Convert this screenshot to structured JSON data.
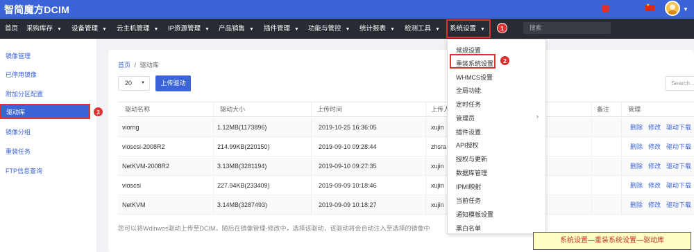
{
  "app": {
    "brand": "智简魔方DCIM"
  },
  "nav": {
    "items": [
      {
        "label": "首页",
        "caret": false
      },
      {
        "label": "采购库存",
        "caret": true
      },
      {
        "label": "设备管理",
        "caret": true
      },
      {
        "label": "云主机管理",
        "caret": true
      },
      {
        "label": "IP资源管理",
        "caret": true
      },
      {
        "label": "产品销售",
        "caret": true
      },
      {
        "label": "插件管理",
        "caret": true
      },
      {
        "label": "功能与管控",
        "caret": true
      },
      {
        "label": "统计报表",
        "caret": true
      },
      {
        "label": "检测工具",
        "caret": true
      },
      {
        "label": "系统设置",
        "caret": true
      }
    ],
    "search_placeholder": "搜索"
  },
  "badges": {
    "one": "1",
    "two": "2",
    "three": "3"
  },
  "sidebar": {
    "items": [
      {
        "label": "镜像管理"
      },
      {
        "label": "已停用镜像"
      },
      {
        "label": "附加分区配置"
      },
      {
        "label": "驱动库"
      },
      {
        "label": "镜像分组"
      },
      {
        "label": "重装任务"
      },
      {
        "label": "FTP信息查询"
      }
    ]
  },
  "breadcrumb": {
    "home": "首页",
    "separator": "/",
    "current": "驱动库"
  },
  "toolbar": {
    "page_size": "20",
    "upload_label": "上传驱动",
    "search_placeholder": "Search..."
  },
  "table": {
    "headers": [
      "驱动名称",
      "驱动大小",
      "上传时间",
      "上传人",
      "备注",
      "管理"
    ],
    "rows": [
      {
        "name": "viorng",
        "size": "1.12MB(1173896)",
        "time": "2019-10-25 16:36:05",
        "user": "xujin"
      },
      {
        "name": "vioscsi-2008R2",
        "size": "214.99KB(220150)",
        "time": "2019-09-10 09:28:44",
        "user": "zhsra"
      },
      {
        "name": "NetKVM-2008R2",
        "size": "3.13MB(3281194)",
        "time": "2019-09-10 09:27:35",
        "user": "xujin"
      },
      {
        "name": "vioscsi",
        "size": "227.94KB(233409)",
        "time": "2019-09-09 10:18:46",
        "user": "xujin"
      },
      {
        "name": "NetKVM",
        "size": "3.14MB(3287493)",
        "time": "2019-09-09 10:18:27",
        "user": "xujin"
      }
    ],
    "actions": {
      "delete": "删除",
      "edit": "修改",
      "download": "驱动下载"
    }
  },
  "hint": "您可以将Wdinwos驱动上传至DCIM，随后在镜像管理-修改中，选择该驱动，该驱动将会自动注入至选择的镜像中",
  "dropdown": {
    "items": [
      {
        "label": "常规设置"
      },
      {
        "label": "重装系统设置"
      },
      {
        "label": "WHMCS设置"
      },
      {
        "label": "全局功能"
      },
      {
        "label": "定时任务"
      },
      {
        "label": "管理员",
        "submenu": true
      },
      {
        "label": "插件设置"
      },
      {
        "label": "API授权"
      },
      {
        "label": "授权与更新"
      },
      {
        "label": "数据库管理"
      },
      {
        "label": "IPMI映射"
      },
      {
        "label": "当前任务"
      },
      {
        "label": "通知模板设置"
      },
      {
        "label": "黑白名单"
      }
    ]
  },
  "caption": "系统设置—重装系统设置—驱动库",
  "colors": {
    "brand_blue": "#3a64d8",
    "nav_dark": "#292b33",
    "highlight_red": "#e03131"
  }
}
